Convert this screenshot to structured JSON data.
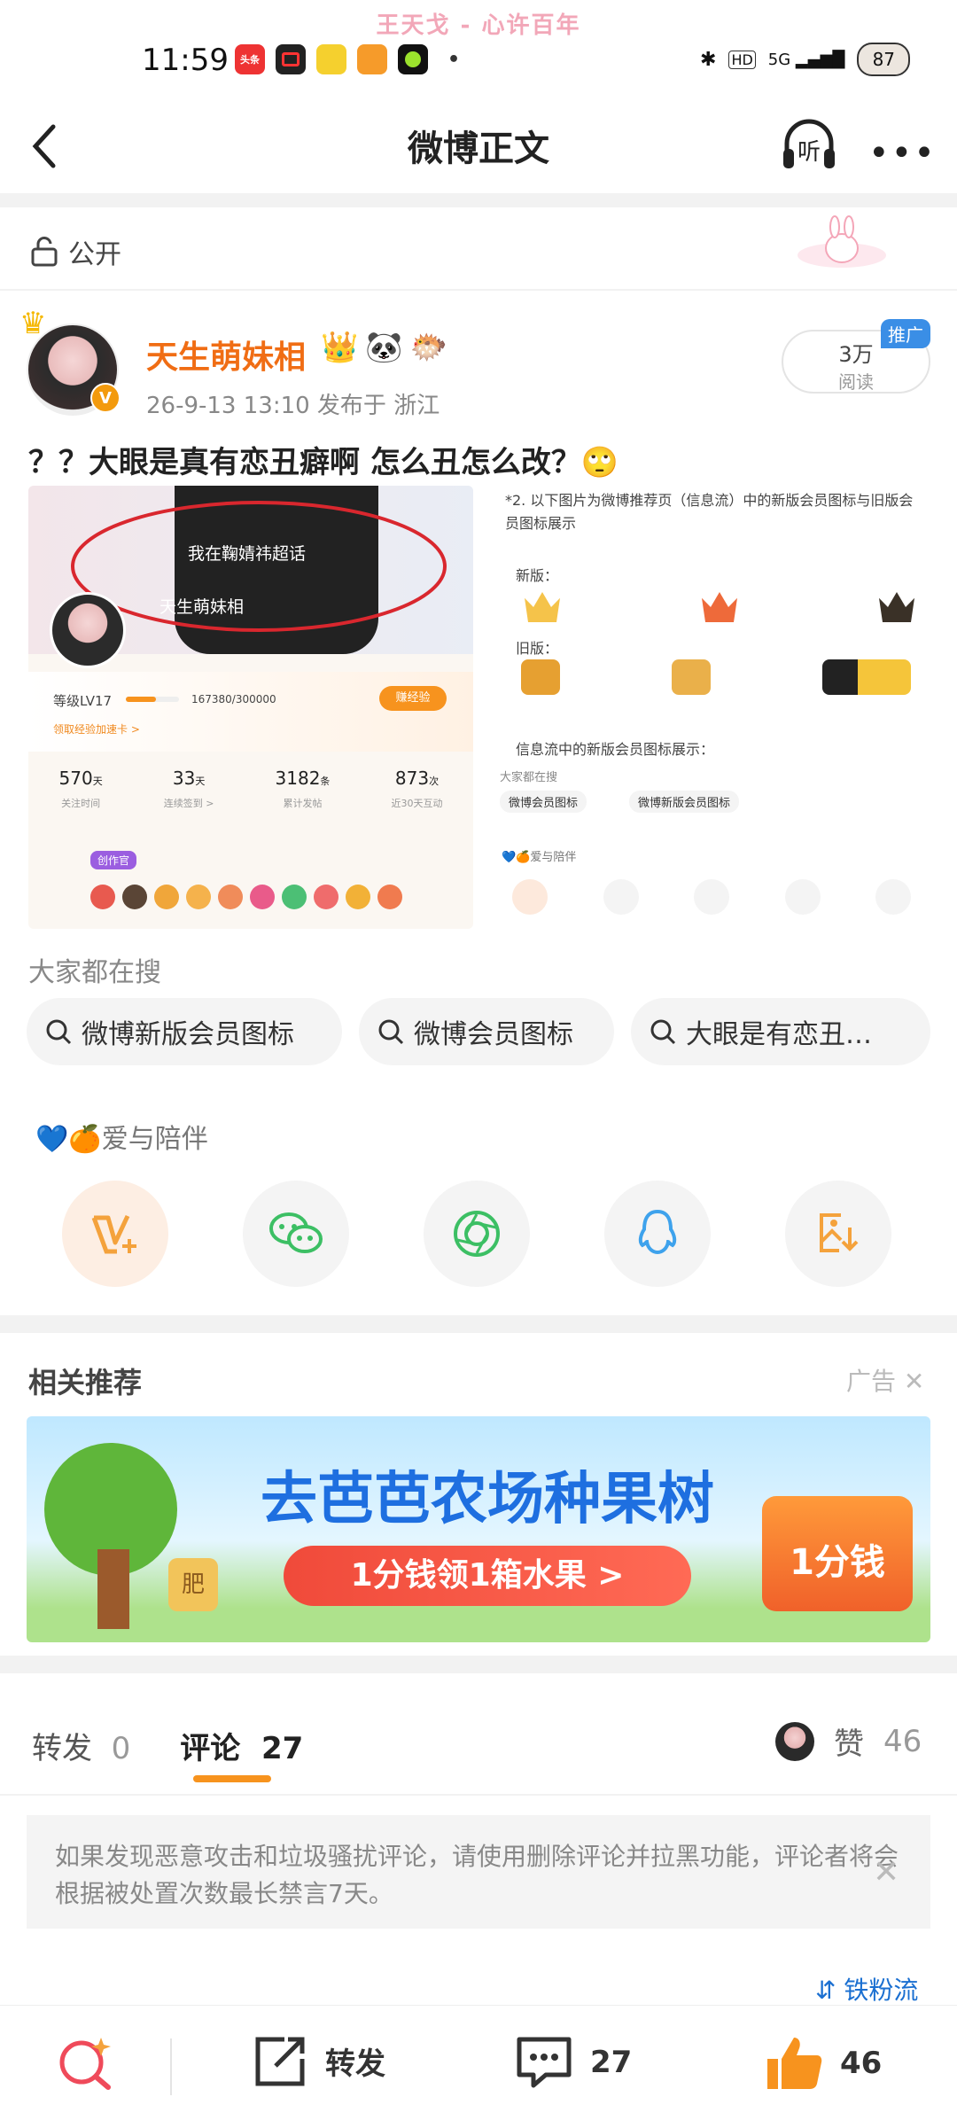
{
  "watermark": "王天戈 - 心许百年",
  "status": {
    "time": "11:59",
    "signal": "5G",
    "battery": "87",
    "app_icons": [
      "头条",
      "",
      "",
      "",
      "",
      ""
    ]
  },
  "header": {
    "title": "微博正文",
    "listen_label": "听",
    "more_label": "•••"
  },
  "visibility": {
    "label": "公开"
  },
  "author": {
    "name": "天生萌妹相",
    "meta": "26-9-13 13:10  发布于 浙江",
    "reads_value": "3万",
    "reads_label": "阅读",
    "promo": "推广",
    "badges": [
      "👑",
      "🐼",
      "🐡"
    ]
  },
  "post": {
    "text": "？？大眼是真有恋丑癖啊 怎么丑怎么改？🙄"
  },
  "img1": {
    "ring_text": "我在鞠婧祎超话",
    "name_tag": "天生萌妹相",
    "level": "等级LV17",
    "exp": "167380/300000",
    "exp_btn": "赚经验",
    "exp_link": "领取经验加速卡 >",
    "stats": [
      {
        "num": "570",
        "unit": "天",
        "label": "关注时间"
      },
      {
        "num": "33",
        "unit": "天",
        "label": "连续签到 >"
      },
      {
        "num": "3182",
        "unit": "条",
        "label": "累计发帖"
      },
      {
        "num": "873",
        "unit": "次",
        "label": "近30天互动"
      }
    ],
    "tag": "创作官"
  },
  "img2": {
    "note": "*2. 以下图片为微博推荐页（信息流）中的新版会员图标与旧版会员图标展示",
    "new_label": "新版：",
    "old_label": "旧版：",
    "feed_label": "信息流中的新版会员图标展示：",
    "search_label": "大家都在搜",
    "chips": [
      "微博会员图标",
      "微博新版会员图标"
    ],
    "love": "💙🍊爱与陪伴"
  },
  "hot_search": {
    "title": "大家都在搜",
    "chips": [
      "微博新版会员图标",
      "微博会员图标",
      "大眼是有恋丑…"
    ]
  },
  "love_label": "💙🍊爱与陪伴",
  "share_icons": [
    "vip-share-icon",
    "wechat-icon",
    "moments-icon",
    "qq-icon",
    "save-image-icon"
  ],
  "recommend": {
    "title": "相关推荐",
    "ad_label": "广告",
    "banner_title": "去芭芭农场种果树",
    "banner_button": "1分钱领1箱水果 >",
    "banner_tag": "1分钱",
    "banner_pot": "肥"
  },
  "tabs": {
    "repost_label": "转发",
    "repost_count": "0",
    "comment_label": "评论",
    "comment_count": "27",
    "like_label": "赞",
    "like_count": "46"
  },
  "notice": {
    "text": "如果发现恶意攻击和垃圾骚扰评论，请使用删除评论并拉黑功能，评论者将会根据被处置次数最长禁言7天。"
  },
  "fans": {
    "label": "铁粉流"
  },
  "bottom_bar": {
    "repost_label": "转发",
    "comment_count": "27",
    "like_count": "46"
  },
  "colors": {
    "accent": "#f7931e",
    "name": "#f06d14",
    "link": "#1a6fd1"
  }
}
